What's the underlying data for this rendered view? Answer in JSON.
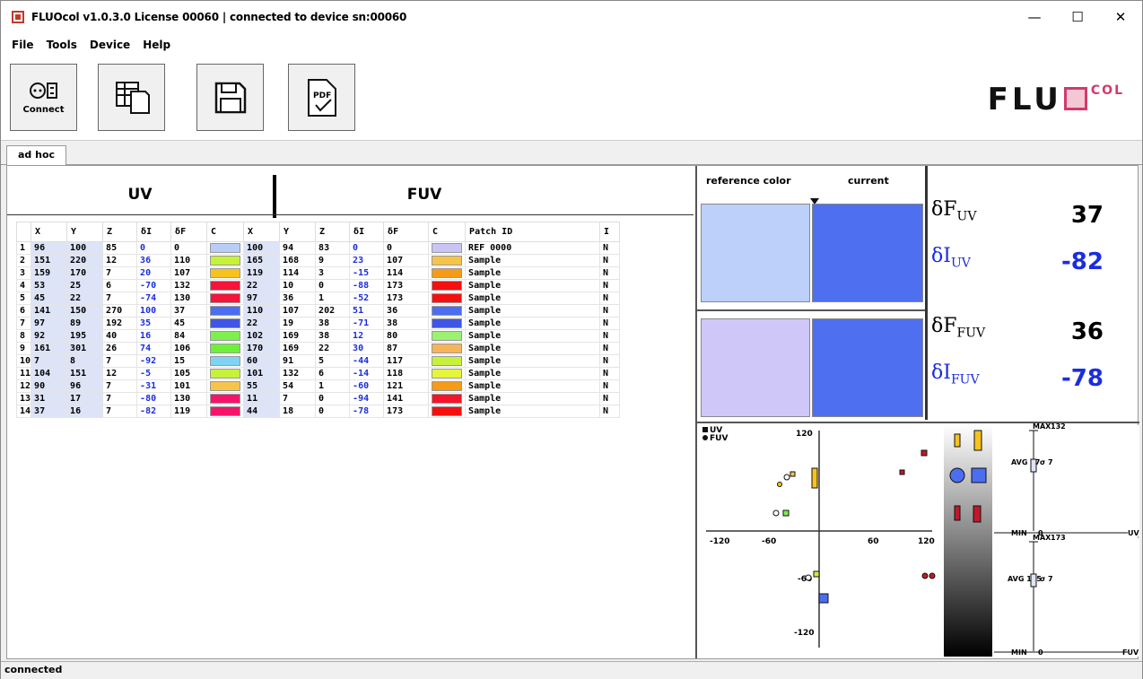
{
  "window": {
    "title": "FLUOcol v1.0.3.0 License 00060 | connected to device sn:00060"
  },
  "menu": [
    "File",
    "Tools",
    "Device",
    "Help"
  ],
  "toolbar": {
    "connect_label": "Connect"
  },
  "logo": {
    "main": "FLU",
    "suffix": "COL"
  },
  "tab": {
    "label": "ad hoc"
  },
  "table": {
    "section_uv": "UV",
    "section_fuv": "FUV",
    "headers": [
      "",
      "X",
      "Y",
      "Z",
      "δI",
      "δF",
      "C",
      "X",
      "Y",
      "Z",
      "δI",
      "δF",
      "C",
      "Patch ID",
      "I"
    ],
    "rows": [
      {
        "n": "1",
        "x": "96",
        "y": "100",
        "z": "85",
        "di": "0",
        "df": "0",
        "c": "#b9cdf6",
        "x2": "100",
        "y2": "94",
        "z2": "83",
        "di2": "0",
        "df2": "0",
        "c2": "#c9c4f4",
        "pid": "REF 0000",
        "i": "N"
      },
      {
        "n": "2",
        "x": "151",
        "y": "220",
        "z": "12",
        "di": "36",
        "df": "110",
        "c": "#c6f23a",
        "x2": "165",
        "y2": "168",
        "z2": "9",
        "di2": "23",
        "df2": "107",
        "c2": "#f7c44a",
        "pid": "Sample",
        "i": "N"
      },
      {
        "n": "3",
        "x": "159",
        "y": "170",
        "z": "7",
        "di": "20",
        "df": "107",
        "c": "#f7c21e",
        "x2": "119",
        "y2": "114",
        "z2": "3",
        "di2": "-15",
        "df2": "114",
        "c2": "#f59b18",
        "pid": "Sample",
        "i": "N"
      },
      {
        "n": "4",
        "x": "53",
        "y": "25",
        "z": "6",
        "di": "-70",
        "df": "132",
        "c": "#f5143a",
        "x2": "22",
        "y2": "10",
        "z2": "0",
        "di2": "-88",
        "df2": "173",
        "c2": "#f51010",
        "pid": "Sample",
        "i": "N"
      },
      {
        "n": "5",
        "x": "45",
        "y": "22",
        "z": "7",
        "di": "-74",
        "df": "130",
        "c": "#f5143a",
        "x2": "97",
        "y2": "36",
        "z2": "1",
        "di2": "-52",
        "df2": "173",
        "c2": "#f51010",
        "pid": "Sample",
        "i": "N"
      },
      {
        "n": "6",
        "x": "141",
        "y": "150",
        "z": "270",
        "di": "100",
        "df": "37",
        "c": "#4b6ef0",
        "x2": "110",
        "y2": "107",
        "z2": "202",
        "di2": "51",
        "df2": "36",
        "c2": "#4b6ef0",
        "pid": "Sample",
        "i": "N"
      },
      {
        "n": "7",
        "x": "97",
        "y": "89",
        "z": "192",
        "di": "35",
        "df": "45",
        "c": "#3f55e6",
        "x2": "22",
        "y2": "19",
        "z2": "38",
        "di2": "-71",
        "df2": "38",
        "c2": "#3f55e6",
        "pid": "Sample",
        "i": "N"
      },
      {
        "n": "8",
        "x": "92",
        "y": "195",
        "z": "40",
        "di": "16",
        "df": "84",
        "c": "#7eef4e",
        "x2": "102",
        "y2": "169",
        "z2": "38",
        "di2": "12",
        "df2": "80",
        "c2": "#9bf270",
        "pid": "Sample",
        "i": "N"
      },
      {
        "n": "9",
        "x": "161",
        "y": "301",
        "z": "26",
        "di": "74",
        "df": "106",
        "c": "#6ef03a",
        "x2": "170",
        "y2": "169",
        "z2": "22",
        "di2": "30",
        "df2": "87",
        "c2": "#f7b45a",
        "pid": "Sample",
        "i": "N"
      },
      {
        "n": "10",
        "x": "7",
        "y": "8",
        "z": "7",
        "di": "-92",
        "df": "15",
        "c": "#7fd4f5",
        "x2": "60",
        "y2": "91",
        "z2": "5",
        "di2": "-44",
        "df2": "117",
        "c2": "#c6f23a",
        "pid": "Sample",
        "i": "N"
      },
      {
        "n": "11",
        "x": "104",
        "y": "151",
        "z": "12",
        "di": "-5",
        "df": "105",
        "c": "#c6f23a",
        "x2": "101",
        "y2": "132",
        "z2": "6",
        "di2": "-14",
        "df2": "118",
        "c2": "#e6f53a",
        "pid": "Sample",
        "i": "N"
      },
      {
        "n": "12",
        "x": "90",
        "y": "96",
        "z": "7",
        "di": "-31",
        "df": "101",
        "c": "#f7c44a",
        "x2": "55",
        "y2": "54",
        "z2": "1",
        "di2": "-60",
        "df2": "121",
        "c2": "#f59b18",
        "pid": "Sample",
        "i": "N"
      },
      {
        "n": "13",
        "x": "31",
        "y": "17",
        "z": "7",
        "di": "-80",
        "df": "130",
        "c": "#f5146a",
        "x2": "11",
        "y2": "7",
        "z2": "0",
        "di2": "-94",
        "df2": "141",
        "c2": "#f51428",
        "pid": "Sample",
        "i": "N"
      },
      {
        "n": "14",
        "x": "37",
        "y": "16",
        "z": "7",
        "di": "-82",
        "df": "119",
        "c": "#f5146a",
        "x2": "44",
        "y2": "18",
        "z2": "0",
        "di2": "-78",
        "df2": "173",
        "c2": "#f51010",
        "pid": "Sample",
        "i": "N"
      }
    ]
  },
  "compare": {
    "reference_label": "reference color",
    "current_label": "current",
    "uv_ref_color": "#bcd0fa",
    "uv_cur_color": "#4d6ff0",
    "fuv_ref_color": "#cfc7f7",
    "fuv_cur_color": "#4d6ff0"
  },
  "deltas": {
    "dF_uv_label": "δF",
    "dF_uv_sub": "UV",
    "dF_uv": "37",
    "dI_uv_label": "δI",
    "dI_uv_sub": "UV",
    "dI_uv": "-82",
    "dF_fuv_label": "δF",
    "dF_fuv_sub": "FUV",
    "dF_fuv": "36",
    "dI_fuv_label": "δI",
    "dI_fuv_sub": "FUV",
    "dI_fuv": "-78"
  },
  "scatter": {
    "legend": [
      "UV",
      "FUV"
    ],
    "xticks": [
      "-120",
      "-60",
      "60",
      "120"
    ],
    "yticks": [
      "120",
      "-60",
      "-120"
    ]
  },
  "gauges": {
    "uv": {
      "max": "MAX",
      "max_val": "132",
      "avg": "AVG 87",
      "sigma": "σ 7",
      "min": "MIN",
      "min_val": "0",
      "label": "UV"
    },
    "fuv": {
      "max": "MAX",
      "max_val": "173",
      "avg": "AVG 105",
      "sigma": "σ 7",
      "min": "MIN",
      "min_val": "0",
      "label": "FUV"
    }
  },
  "status": {
    "text": "connected"
  }
}
